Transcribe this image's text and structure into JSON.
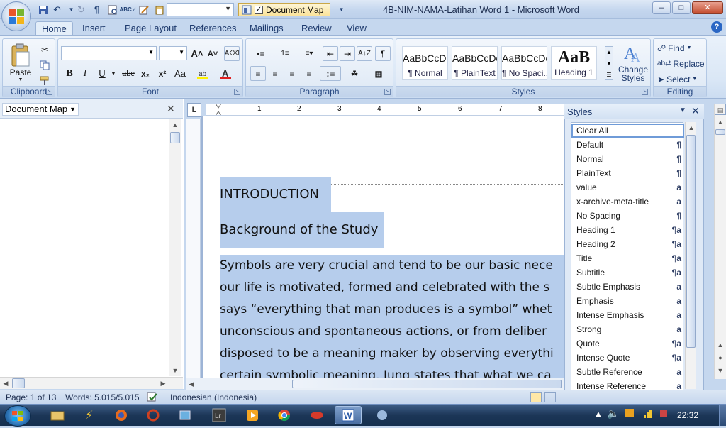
{
  "window": {
    "title": "4B-NIM-NAMA-Latihan Word 1 - Microsoft Word",
    "qat_document_map_label": "Document Map",
    "minimize": "–",
    "maximize": "□",
    "close": "✕"
  },
  "tabs": [
    {
      "label": "Home",
      "active": true
    },
    {
      "label": "Insert"
    },
    {
      "label": "Page Layout"
    },
    {
      "label": "References"
    },
    {
      "label": "Mailings"
    },
    {
      "label": "Review"
    },
    {
      "label": "View"
    }
  ],
  "ribbon": {
    "clipboard": {
      "label": "Clipboard",
      "paste": "Paste"
    },
    "font": {
      "label": "Font",
      "name_value": "",
      "size_value": "",
      "bold": "B",
      "italic": "I",
      "underline": "U",
      "strike": "abc",
      "subscript": "x₂",
      "superscript": "x²",
      "change_case": "Aa",
      "grow": "A˄",
      "shrink": "A˅"
    },
    "paragraph": {
      "label": "Paragraph"
    },
    "styles": {
      "label": "Styles",
      "tiles": [
        {
          "sample": "AaBbCcDc",
          "name": "¶ Normal"
        },
        {
          "sample": "AaBbCcDc",
          "name": "¶ PlainText"
        },
        {
          "sample": "AaBbCcDc",
          "name": "¶ No Spaci..."
        },
        {
          "sample": "AaB",
          "name": "Heading 1"
        }
      ],
      "change_styles": "Change Styles"
    },
    "editing": {
      "label": "Editing",
      "find": "Find",
      "replace": "Replace",
      "select": "Select"
    }
  },
  "docmap": {
    "title": "Document Map",
    "close": "✕"
  },
  "ruler": {
    "ticks": [
      "1",
      "2",
      "3",
      "4",
      "5",
      "6",
      "7",
      "8"
    ],
    "corner": "L"
  },
  "document": {
    "heading1": "INTRODUCTION",
    "heading2": "Background of the Study",
    "lines": [
      "Symbols are very crucial and tend to be our basic nece",
      "our life is motivated, formed and celebrated with the s",
      "says “everything that man produces is a symbol” whet",
      "unconscious and spontaneous actions, or from deliber",
      "disposed to be a meaning maker by observing everythi",
      "certain symbolic meaning. Jung states that what we ca"
    ]
  },
  "styles_pane": {
    "title": "Styles",
    "items": [
      {
        "name": "Clear All",
        "mark": "",
        "selected": true
      },
      {
        "name": "Default",
        "mark": "¶"
      },
      {
        "name": "Normal",
        "mark": "¶"
      },
      {
        "name": "PlainText",
        "mark": "¶"
      },
      {
        "name": "value",
        "mark": "a"
      },
      {
        "name": "x-archive-meta-title",
        "mark": "a"
      },
      {
        "name": "No Spacing",
        "mark": "¶"
      },
      {
        "name": "Heading 1",
        "mark": "¶a"
      },
      {
        "name": "Heading 2",
        "mark": "¶a"
      },
      {
        "name": "Title",
        "mark": "¶a"
      },
      {
        "name": "Subtitle",
        "mark": "¶a"
      },
      {
        "name": "Subtle Emphasis",
        "mark": "a"
      },
      {
        "name": "Emphasis",
        "mark": "a"
      },
      {
        "name": "Intense Emphasis",
        "mark": "a"
      },
      {
        "name": "Strong",
        "mark": "a"
      },
      {
        "name": "Quote",
        "mark": "¶a"
      },
      {
        "name": "Intense Quote",
        "mark": "¶a"
      },
      {
        "name": "Subtle Reference",
        "mark": "a"
      },
      {
        "name": "Intense Reference",
        "mark": "a"
      }
    ]
  },
  "status": {
    "page": "Page: 1 of 13",
    "words": "Words: 5.015/5.015",
    "language": "Indonesian (Indonesia)"
  },
  "taskbar": {
    "clock": "22:32"
  }
}
